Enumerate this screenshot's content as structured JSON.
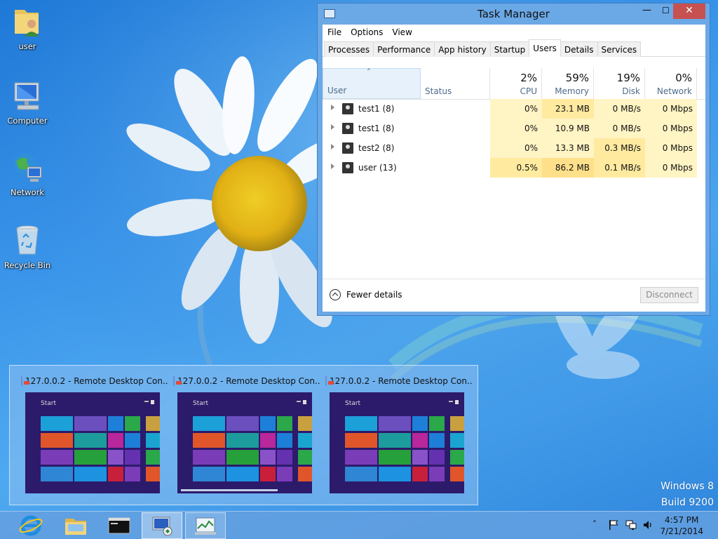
{
  "watermark": {
    "line1": "Windows 8",
    "line2": "Build 9200"
  },
  "desktop_icons": [
    {
      "label": "user",
      "icon": "user-folder-icon"
    },
    {
      "label": "Computer",
      "icon": "computer-icon"
    },
    {
      "label": "Network",
      "icon": "network-icon"
    },
    {
      "label": "Recycle Bin",
      "icon": "recycle-bin-icon"
    }
  ],
  "task_manager": {
    "title": "Task Manager",
    "window_buttons": {
      "minimize": "—",
      "maximize": "☐",
      "close": "✕"
    },
    "menu": [
      "File",
      "Options",
      "View"
    ],
    "tabs": [
      "Processes",
      "Performance",
      "App history",
      "Startup",
      "Users",
      "Details",
      "Services"
    ],
    "active_tab": "Users",
    "sort_indicator": "˄",
    "columns": {
      "user": "User",
      "status": "Status",
      "cpu": {
        "pct": "2%",
        "name": "CPU"
      },
      "memory": {
        "pct": "59%",
        "name": "Memory"
      },
      "disk": {
        "pct": "19%",
        "name": "Disk"
      },
      "network": {
        "pct": "0%",
        "name": "Network"
      }
    },
    "rows": [
      {
        "name": "test1 (8)",
        "status": "",
        "cpu": "0%",
        "memory": "23.1 MB",
        "disk": "0 MB/s",
        "network": "0 Mbps"
      },
      {
        "name": "test1 (8)",
        "status": "",
        "cpu": "0%",
        "memory": "10.9 MB",
        "disk": "0 MB/s",
        "network": "0 Mbps"
      },
      {
        "name": "test2 (8)",
        "status": "",
        "cpu": "0%",
        "memory": "13.3 MB",
        "disk": "0.3 MB/s",
        "network": "0 Mbps"
      },
      {
        "name": "user (13)",
        "status": "",
        "cpu": "0.5%",
        "memory": "86.2 MB",
        "disk": "0.1 MB/s",
        "network": "0 Mbps"
      }
    ],
    "fewer_details": "Fewer details",
    "disconnect": "Disconnect"
  },
  "thumbnails": [
    {
      "title": "127.0.0.2 - Remote Desktop Con...",
      "start_label": "Start"
    },
    {
      "title": "127.0.0.2 - Remote Desktop Con...",
      "start_label": "Start"
    },
    {
      "title": "127.0.0.2 - Remote Desktop Con...",
      "start_label": "Start"
    }
  ],
  "taskbar": {
    "buttons": [
      {
        "name": "internet-explorer-button",
        "icon": "internet-explorer-icon"
      },
      {
        "name": "file-explorer-button",
        "icon": "folder-icon"
      },
      {
        "name": "command-prompt-button",
        "icon": "command-prompt-icon"
      },
      {
        "name": "remote-desktop-button",
        "icon": "remote-desktop-icon"
      },
      {
        "name": "task-manager-button",
        "icon": "task-manager-icon"
      }
    ],
    "tray": {
      "show_hidden": "˄",
      "time": "4:57 PM",
      "date": "7/21/2014"
    }
  },
  "colors": {
    "heat_light": "#fff4c4",
    "heat_mid": "#ffeaa0",
    "heat_strong": "#ffe08a",
    "accent_close": "#c75050"
  }
}
